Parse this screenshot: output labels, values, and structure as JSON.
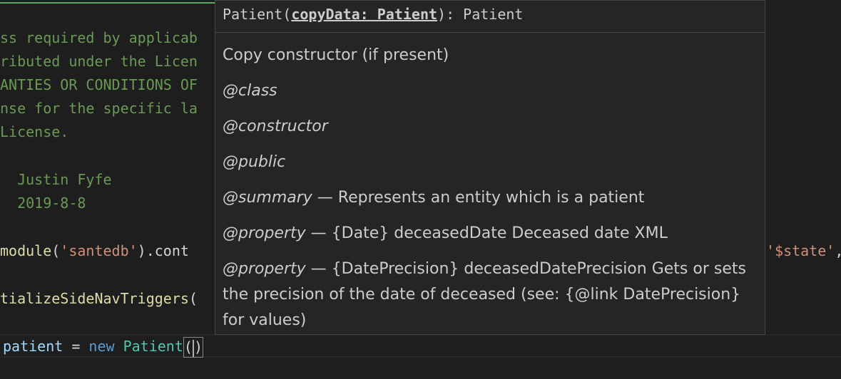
{
  "editor": {
    "lines": {
      "l1": "ss required by applicab",
      "l2": "ributed under the Licen",
      "l3": "ANTIES OR CONDITIONS OF",
      "l4": "nse for the specific la",
      "l5": "License.",
      "l6": "  Justin Fyfe",
      "l7": "  2019-8-8",
      "l8_fn": "module",
      "l8_open": "(",
      "l8_str": "'santedb'",
      "l8_rest": ").cont",
      "l8_right": "'$state'",
      "l8_right_punc": ",",
      "l9_fn": "tializeSideNavTriggers",
      "l9_punc": "(",
      "l10_var": "patient",
      "l10_eq": " = ",
      "l10_kw": "new",
      "l10_cls": "Patient",
      "l10_open": "(",
      "l10_close": ")"
    }
  },
  "hover": {
    "signature": {
      "name": "Patient(",
      "param": "copyData: Patient",
      "suffix": "): Patient"
    },
    "doc": {
      "summary": "Copy constructor (if present)",
      "tags": [
        {
          "tag": "@class",
          "text": ""
        },
        {
          "tag": "@constructor",
          "text": ""
        },
        {
          "tag": "@public",
          "text": ""
        },
        {
          "tag": "@summary",
          "text": " — Represents an entity which is a patient"
        },
        {
          "tag": "@property",
          "text": " — {Date} deceasedDate Deceased date XML"
        },
        {
          "tag": "@property",
          "text": " — {DatePrecision} deceasedDatePrecision Gets or sets the precision of the date of deceased (see: {@link DatePrecision} for values)"
        }
      ]
    }
  }
}
